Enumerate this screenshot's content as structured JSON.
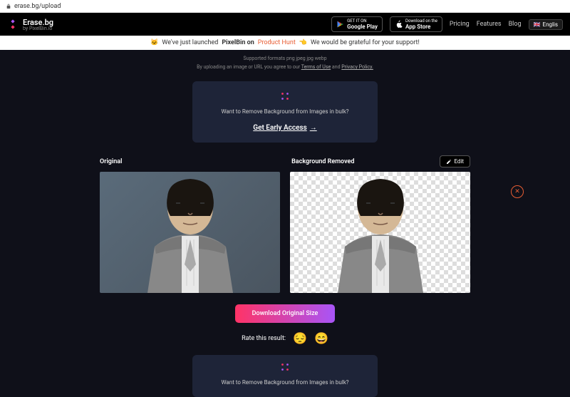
{
  "url": "erase.bg/upload",
  "logo": {
    "name": "Erase.bg",
    "sub": "by PixelBin.io"
  },
  "stores": {
    "google": {
      "top": "GET IT ON",
      "name": "Google Play"
    },
    "apple": {
      "top": "Download on the",
      "name": "App Store"
    }
  },
  "nav": {
    "pricing": "Pricing",
    "features": "Features",
    "blog": "Blog"
  },
  "lang": "Englis",
  "banner": {
    "pre": "We've just launched",
    "product": "PixelBin on",
    "ph": "Product Hunt",
    "post": "We would be grateful for your support!"
  },
  "upload": {
    "formats": "Supported formats   png   jpeg   jpg   webp",
    "terms_pre": "By uploading an image or URL you agree to our",
    "terms": "Terms of Use",
    "and": "and",
    "privacy": "Privacy Policy."
  },
  "bulk": {
    "question": "Want to Remove Background from Images in bulk?",
    "cta": "Get Early Access"
  },
  "result": {
    "original": "Original",
    "removed": "Background Removed",
    "edit": "Edit",
    "download": "Download Original Size",
    "rate": "Rate this result:"
  }
}
